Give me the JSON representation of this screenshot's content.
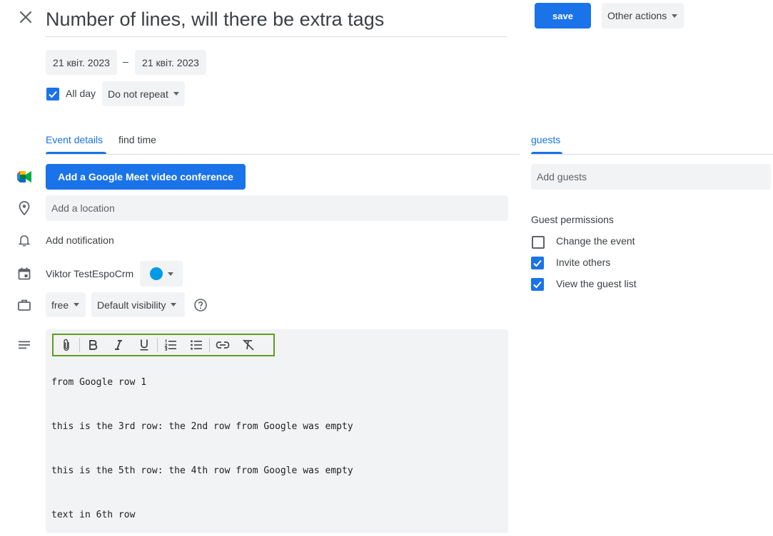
{
  "header": {
    "title": "Number of lines, will there be extra tags",
    "save_label": "save",
    "other_actions_label": "Other actions"
  },
  "dates": {
    "start": "21 квіт. 2023",
    "separator": "–",
    "end": "21 квіт. 2023"
  },
  "options": {
    "all_day_label": "All day",
    "all_day_checked": true,
    "repeat_label": "Do not repeat"
  },
  "tabs": [
    {
      "label": "Event details",
      "active": true
    },
    {
      "label": "find time",
      "active": false
    }
  ],
  "details": {
    "meet_button_label": "Add a Google Meet video conference",
    "location_placeholder": "Add a location",
    "notification_label": "Add notification",
    "calendar_owner": "Viktor TestEspoCrm",
    "calendar_color": "#039be5",
    "availability_label": "free",
    "visibility_label": "Default visibility"
  },
  "description": {
    "lines": [
      "from Google row 1",
      "this is the 3rd row: the 2nd row from Google was empty",
      "this is the 5th row: the 4th row from Google was empty",
      "text in 6th row"
    ]
  },
  "guests": {
    "tab_label": "guests",
    "input_placeholder": "Add guests",
    "permissions_title": "Guest permissions",
    "permissions": [
      {
        "label": "Change the event",
        "checked": false
      },
      {
        "label": "Invite others",
        "checked": true
      },
      {
        "label": "View the guest list",
        "checked": true
      }
    ]
  },
  "colors": {
    "accent": "#1a73e8",
    "toolbar_outline": "#5e9e1f"
  }
}
